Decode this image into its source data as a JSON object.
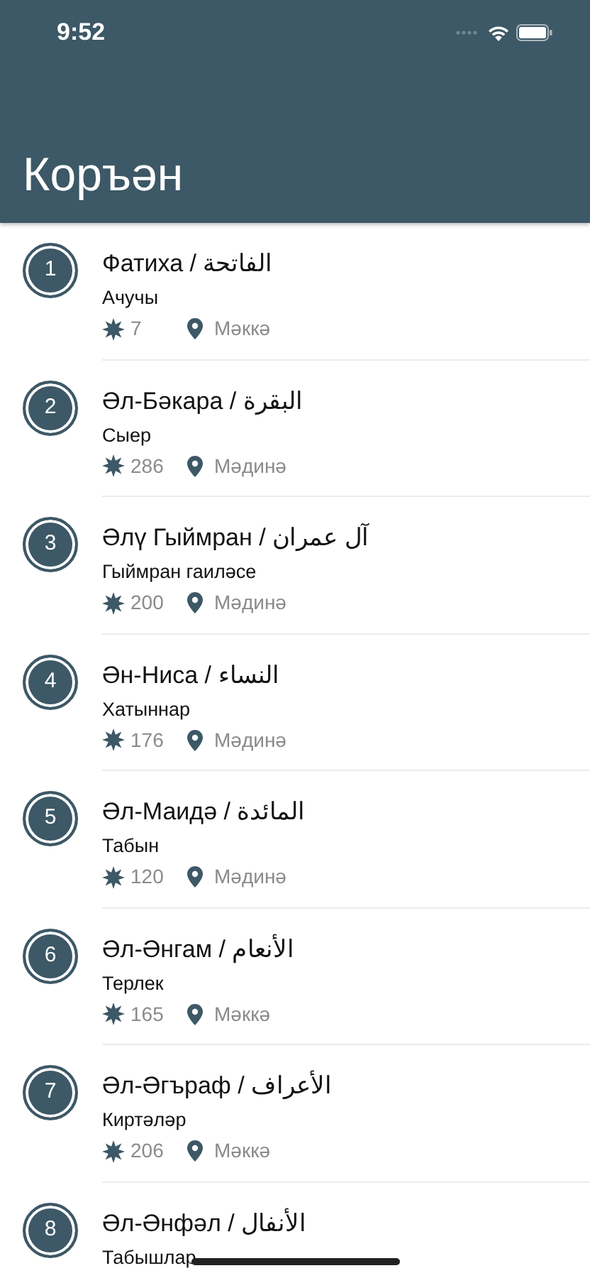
{
  "status_bar": {
    "time": "9:52"
  },
  "header": {
    "title": "Коръән"
  },
  "surahs": [
    {
      "number": "1",
      "title": "Фатиха / الفاتحة",
      "meaning": "Ачучы",
      "verses": "7",
      "place": "Мәккә"
    },
    {
      "number": "2",
      "title": "Әл-Бәкара / البقرة",
      "meaning": "Сыер",
      "verses": "286",
      "place": "Мәдинә"
    },
    {
      "number": "3",
      "title": "Әлү Гыймран / آل عمران",
      "meaning": "Гыймран гаиләсе",
      "verses": "200",
      "place": "Мәдинә"
    },
    {
      "number": "4",
      "title": "Ән-Ниса / النساء",
      "meaning": "Хатыннар",
      "verses": "176",
      "place": "Мәдинә"
    },
    {
      "number": "5",
      "title": "Әл-Маидә / المائدة",
      "meaning": "Табын",
      "verses": "120",
      "place": "Мәдинә"
    },
    {
      "number": "6",
      "title": "Әл-Әнгам / الأنعام",
      "meaning": "Терлек",
      "verses": "165",
      "place": "Мәккә"
    },
    {
      "number": "7",
      "title": "Әл-Әгъраф / الأعراف",
      "meaning": "Киртәләр",
      "verses": "206",
      "place": "Мәккә"
    },
    {
      "number": "8",
      "title": "Әл-Әнфәл / الأنفال",
      "meaning": "Табышлар"
    }
  ]
}
